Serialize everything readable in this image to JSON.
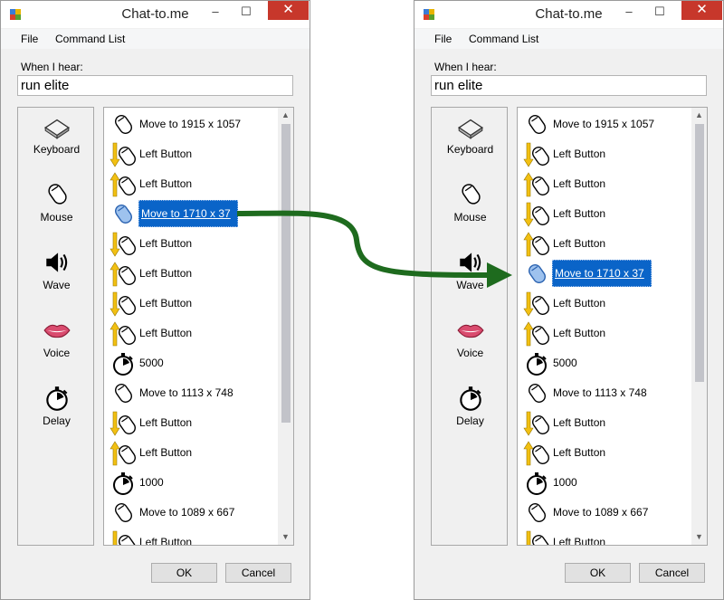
{
  "app": {
    "title": "Chat-to.me",
    "close_glyph": "✕",
    "minimize_glyph": "–",
    "maximize_glyph": "☐"
  },
  "menu": {
    "file": "File",
    "command_list": "Command List"
  },
  "trigger": {
    "label": "When I hear:",
    "value": "run elite"
  },
  "toolbox": [
    {
      "label": "Keyboard",
      "icon": "keyboard-icon"
    },
    {
      "label": "Mouse",
      "icon": "mouse-icon"
    },
    {
      "label": "Wave",
      "icon": "speaker-icon"
    },
    {
      "label": "Voice",
      "icon": "lips-icon"
    },
    {
      "label": "Delay",
      "icon": "stopwatch-icon"
    }
  ],
  "buttons": {
    "ok": "OK",
    "cancel": "Cancel"
  },
  "before": {
    "selected_index": 3,
    "commands": [
      {
        "icon": "mouse-icon",
        "text": "Move to 1915 x 1057"
      },
      {
        "icon": "mouse-down-icon",
        "text": "Left Button"
      },
      {
        "icon": "mouse-up-icon",
        "text": "Left Button"
      },
      {
        "icon": "mouse-move-icon",
        "text": "Move to 1710 x 37"
      },
      {
        "icon": "mouse-down-icon",
        "text": "Left Button"
      },
      {
        "icon": "mouse-up-icon",
        "text": "Left Button"
      },
      {
        "icon": "mouse-down-icon",
        "text": "Left Button"
      },
      {
        "icon": "mouse-up-icon",
        "text": "Left Button"
      },
      {
        "icon": "stopwatch-icon",
        "text": "5000"
      },
      {
        "icon": "mouse-icon",
        "text": "Move to 1113 x 748"
      },
      {
        "icon": "mouse-down-icon",
        "text": "Left Button"
      },
      {
        "icon": "mouse-up-icon",
        "text": "Left Button"
      },
      {
        "icon": "stopwatch-icon",
        "text": "1000"
      },
      {
        "icon": "mouse-icon",
        "text": "Move to 1089 x 667"
      },
      {
        "icon": "mouse-down-icon",
        "text": "Left Button"
      }
    ]
  },
  "after": {
    "selected_index": 5,
    "commands": [
      {
        "icon": "mouse-icon",
        "text": "Move to 1915 x 1057"
      },
      {
        "icon": "mouse-down-icon",
        "text": "Left Button"
      },
      {
        "icon": "mouse-up-icon",
        "text": "Left Button"
      },
      {
        "icon": "mouse-down-icon",
        "text": "Left Button"
      },
      {
        "icon": "mouse-up-icon",
        "text": "Left Button"
      },
      {
        "icon": "mouse-move-icon",
        "text": "Move to 1710 x 37"
      },
      {
        "icon": "mouse-down-icon",
        "text": "Left Button"
      },
      {
        "icon": "mouse-up-icon",
        "text": "Left Button"
      },
      {
        "icon": "stopwatch-icon",
        "text": "5000"
      },
      {
        "icon": "mouse-icon",
        "text": "Move to 1113 x 748"
      },
      {
        "icon": "mouse-down-icon",
        "text": "Left Button"
      },
      {
        "icon": "mouse-up-icon",
        "text": "Left Button"
      },
      {
        "icon": "stopwatch-icon",
        "text": "1000"
      },
      {
        "icon": "mouse-icon",
        "text": "Move to 1089 x 667"
      },
      {
        "icon": "mouse-down-icon",
        "text": "Left Button"
      }
    ]
  },
  "colors": {
    "selection": "#0a64c8",
    "arrow": "#1e6b1e",
    "close": "#c7372b",
    "action_arrow": "#f2c012"
  }
}
